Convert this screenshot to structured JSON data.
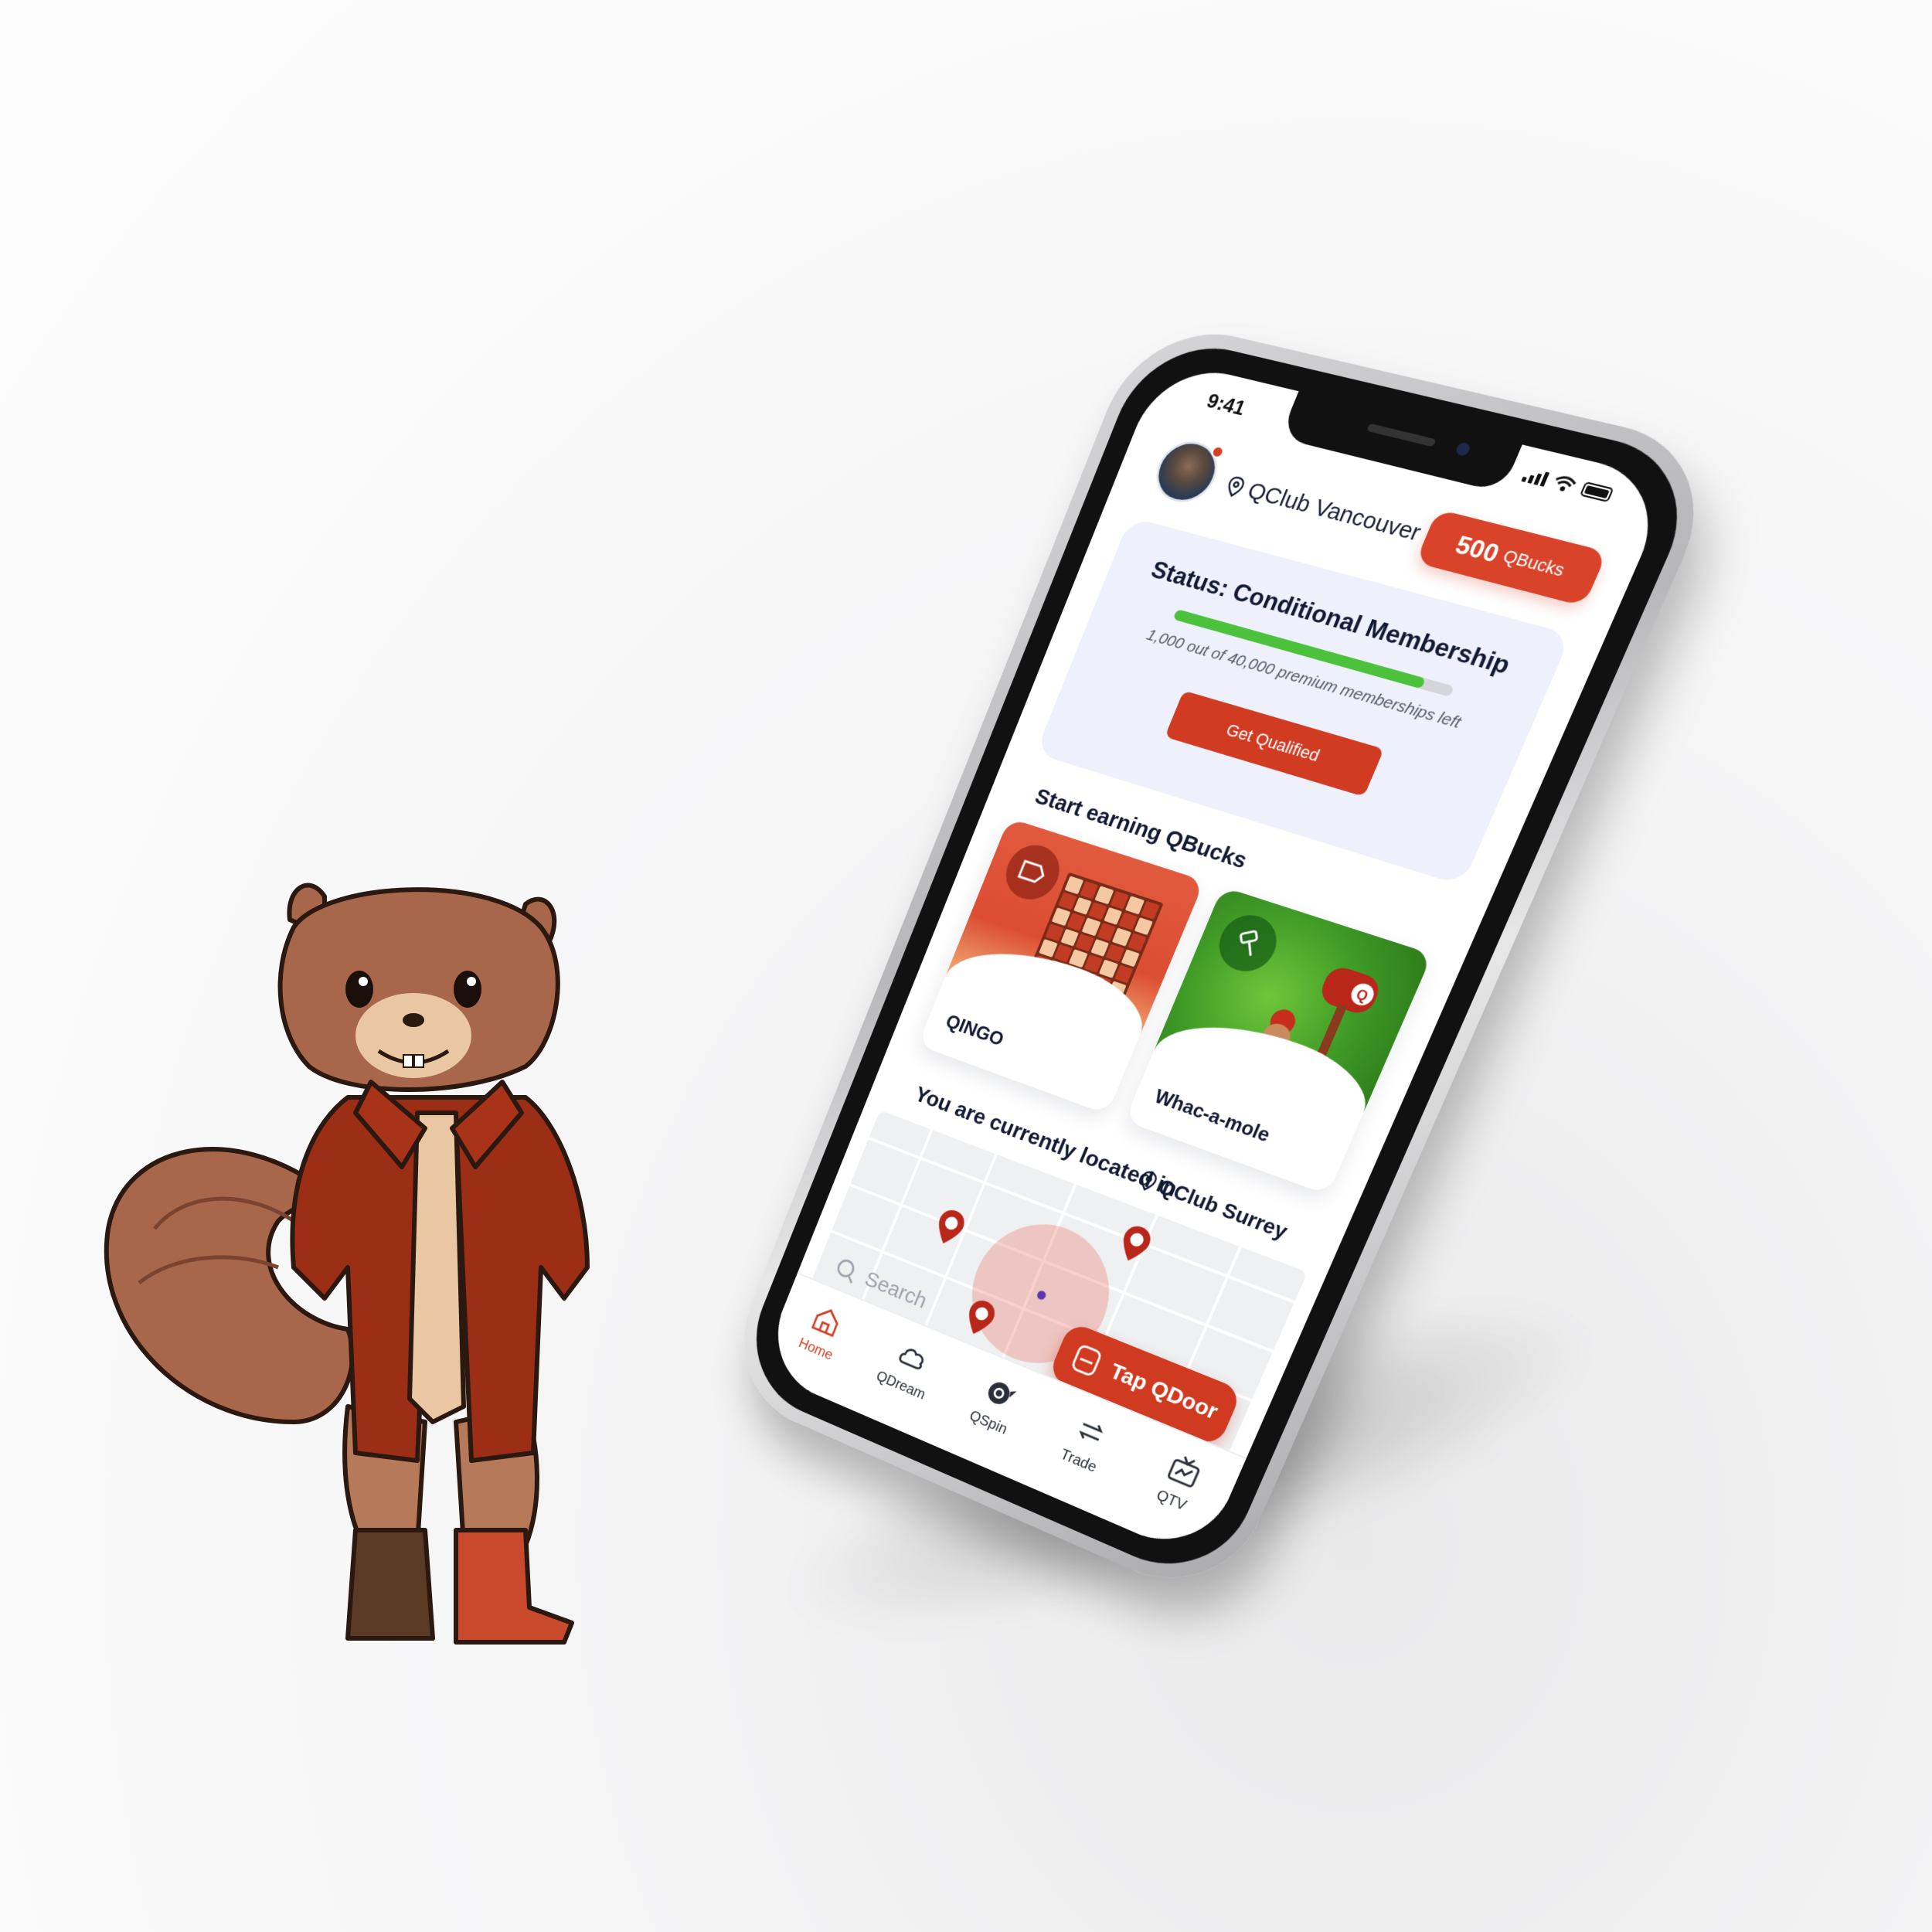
{
  "status_bar": {
    "time": "9:41"
  },
  "header": {
    "location": "QClub Vancouver",
    "qbucks_amount": "500",
    "qbucks_unit": "QBucks"
  },
  "status_card": {
    "title": "Status: Conditional Membership",
    "progress_fraction": 0.9,
    "subtitle": "1,000 out of 40,000 premium memberships left",
    "button_label": "Get Qualified"
  },
  "earning": {
    "title": "Start earning QBucks",
    "games": [
      {
        "label": "QINGO"
      },
      {
        "label": "Whac-a-mole"
      }
    ]
  },
  "location_section": {
    "label": "You are currently located in",
    "value": "QClub Surrey"
  },
  "map": {
    "tap_button_label": "Tap QDoor",
    "search_placeholder": "Search"
  },
  "nav": {
    "items": [
      {
        "label": "Home"
      },
      {
        "label": "QDream"
      },
      {
        "label": "QSpin"
      },
      {
        "label": "Trade"
      },
      {
        "label": "QTV"
      }
    ]
  },
  "colors": {
    "accent": "#d8432a",
    "progress": "#4cc13b",
    "status_card_bg": "#eef1fb"
  },
  "icons": {
    "nav": [
      "home-icon",
      "cloud-icon",
      "qspin-icon",
      "trade-arrows-icon",
      "tv-icon"
    ]
  }
}
